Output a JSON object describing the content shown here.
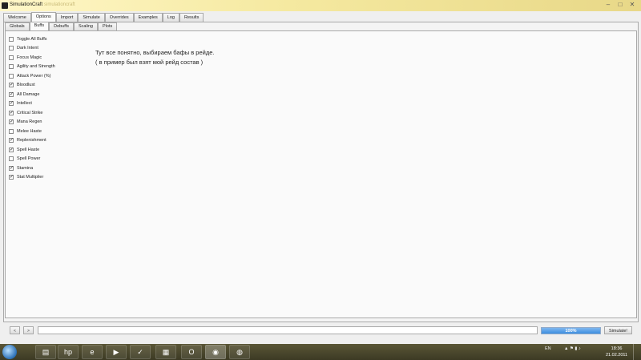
{
  "window": {
    "title": "SimulationCraft",
    "title_ghost": "simulationcraft"
  },
  "main_tabs": [
    "Welcome",
    "Options",
    "Import",
    "Simulate",
    "Overrides",
    "Examples",
    "Log",
    "Results"
  ],
  "main_tab_active": "Options",
  "sub_tabs": [
    "Globals",
    "Buffs",
    "Debuffs",
    "Scaling",
    "Plots"
  ],
  "sub_tab_active": "Buffs",
  "buffs": [
    {
      "label": "Toggle All Buffs",
      "checked": false
    },
    {
      "label": "Dark Intent",
      "checked": false
    },
    {
      "label": "Focus Magic",
      "checked": false
    },
    {
      "label": "Agility and Strength",
      "checked": false
    },
    {
      "label": "Attack Power (%)",
      "checked": false
    },
    {
      "label": "Bloodlust",
      "checked": true
    },
    {
      "label": "All Damage",
      "checked": true
    },
    {
      "label": "Intellect",
      "checked": true
    },
    {
      "label": "Critical Strike",
      "checked": true
    },
    {
      "label": "Mana Regen",
      "checked": true
    },
    {
      "label": "Melee Haste",
      "checked": false
    },
    {
      "label": "Replenishment",
      "checked": true
    },
    {
      "label": "Spell Haste",
      "checked": true
    },
    {
      "label": "Spell Power",
      "checked": false
    },
    {
      "label": "Stamina",
      "checked": true
    },
    {
      "label": "Stat Multiplier",
      "checked": true
    }
  ],
  "note": {
    "line1": "Тут все понятно, выбираем бафы в рейде.",
    "line2": "( в пример был взят мой рейд состав )"
  },
  "bottom": {
    "back_label": "<",
    "forward_label": ">",
    "command_value": "",
    "progress": 1.0,
    "progress_text": "100%",
    "simulate_label": "Simulate!"
  },
  "taskbar": {
    "language": "EN",
    "time": "18:36",
    "date": "21.02.2011",
    "apps": [
      "explorer-icon",
      "hp-icon",
      "ie-icon",
      "media-player-icon",
      "task-icon",
      "game-icon",
      "opera-icon",
      "simulationcraft-icon",
      "app-icon"
    ]
  }
}
